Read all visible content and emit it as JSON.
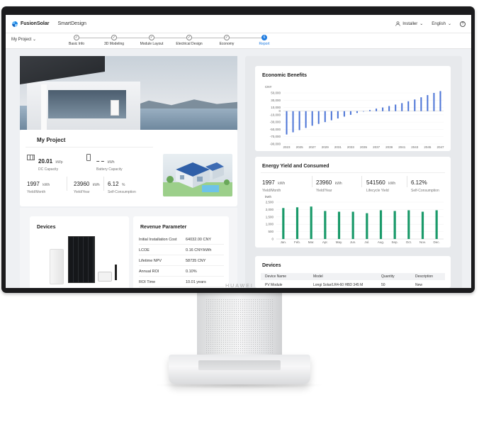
{
  "app": {
    "logo": "FusionSolar",
    "product": "SmartDesign"
  },
  "topbar": {
    "user": "Installer",
    "language": "English",
    "help": "?"
  },
  "project_select": "My Project",
  "steps": [
    {
      "label": "Basic Info",
      "state": "done"
    },
    {
      "label": "3D Modeling",
      "state": "done"
    },
    {
      "label": "Module Layout",
      "state": "done"
    },
    {
      "label": "Electrical Design",
      "state": "done"
    },
    {
      "label": "Economy",
      "state": "done"
    },
    {
      "label": "Report",
      "state": "active",
      "number": "6"
    }
  ],
  "my_project": {
    "title": "My Project",
    "dc_capacity": {
      "value": "20.01",
      "unit": "kWp",
      "label": "DC Capacity"
    },
    "battery": {
      "value": "– –",
      "unit": "kWh",
      "label": "Battery Capacity"
    },
    "yield_month": {
      "value": "1997",
      "unit": "kWh",
      "label": "Yield/Month"
    },
    "yield_year": {
      "value": "23960",
      "unit": "kWh",
      "label": "Yield/Year"
    },
    "self_consumption": {
      "value": "6.12",
      "unit": "%",
      "label": "Self-Consumption"
    }
  },
  "devices": {
    "title": "Devices"
  },
  "revenue": {
    "title": "Revenue Parameter",
    "rows": [
      {
        "label": "Initial Installation Cost",
        "value": "64032.00 CNY"
      },
      {
        "label": "LCOE",
        "value": "0.16 CNY/kWh"
      },
      {
        "label": "Lifetime NPV",
        "value": "58735 CNY"
      },
      {
        "label": "Annual ROI",
        "value": "0.10%"
      },
      {
        "label": "ROI Time",
        "value": "10.01 years"
      }
    ]
  },
  "economic": {
    "title": "Economic Benefits",
    "unit": "CNY",
    "y_ticks": [
      "50,000",
      "30,000",
      "10,000",
      "0",
      "-10,000",
      "-30,000",
      "-50,000",
      "-70,000",
      "-90,000"
    ],
    "x_ticks": [
      "2023",
      "2025",
      "2027",
      "2029",
      "2031",
      "2033",
      "2035",
      "2037",
      "2039",
      "2041",
      "2043",
      "2045",
      "2047"
    ]
  },
  "energy": {
    "title": "Energy Yield and Consumed",
    "stats": [
      {
        "value": "1997",
        "unit": "kWh",
        "label": "Yield/Month"
      },
      {
        "value": "23960",
        "unit": "kWh",
        "label": "Yield/Year"
      },
      {
        "value": "541560",
        "unit": "kWh",
        "label": "Lifecycle Yield"
      },
      {
        "value": "6.12%",
        "unit": "",
        "label": "Self-Consumption"
      }
    ],
    "unit": "kWh",
    "y_ticks": [
      "2,500",
      "2,000",
      "1,500",
      "1,000",
      "500",
      "0"
    ]
  },
  "devices_table": {
    "title": "Devices",
    "headers": [
      "Device Name",
      "Model",
      "Quantity",
      "Description"
    ],
    "row": [
      "PV Module",
      "Longi Solar/LR4-60 HBD 345 M",
      "50",
      "New"
    ]
  },
  "monitor_brand": "HUAWEI",
  "chart_data": [
    {
      "type": "bar",
      "title": "Economic Benefits",
      "ylabel": "CNY",
      "categories": [
        "2023",
        "2024",
        "2025",
        "2026",
        "2027",
        "2028",
        "2029",
        "2030",
        "2031",
        "2032",
        "2033",
        "2034",
        "2035",
        "2036",
        "2037",
        "2038",
        "2039",
        "2040",
        "2041",
        "2042",
        "2043",
        "2044",
        "2045",
        "2046",
        "2047"
      ],
      "values": [
        -64000,
        -58000,
        -52000,
        -46000,
        -40000,
        -35000,
        -30000,
        -25000,
        -20000,
        -15000,
        -10000,
        -5000,
        0,
        3000,
        7000,
        10000,
        14000,
        18000,
        22000,
        27000,
        32000,
        38000,
        44000,
        50000,
        55000
      ],
      "ylim": [
        -90000,
        50000
      ],
      "color": "#4a73d6"
    },
    {
      "type": "bar",
      "title": "Energy Yield and Consumed",
      "ylabel": "kWh",
      "categories": [
        "Jan.",
        "Feb.",
        "Mar.",
        "Apr.",
        "May.",
        "Jun.",
        "Jul.",
        "Aug.",
        "Sep.",
        "Oct.",
        "Nov.",
        "Dec."
      ],
      "values": [
        2100,
        2150,
        2200,
        1900,
        1850,
        1850,
        1750,
        1950,
        1900,
        1950,
        1850,
        1950
      ],
      "ylim": [
        0,
        2500
      ],
      "color": "#1a9a6a"
    }
  ]
}
